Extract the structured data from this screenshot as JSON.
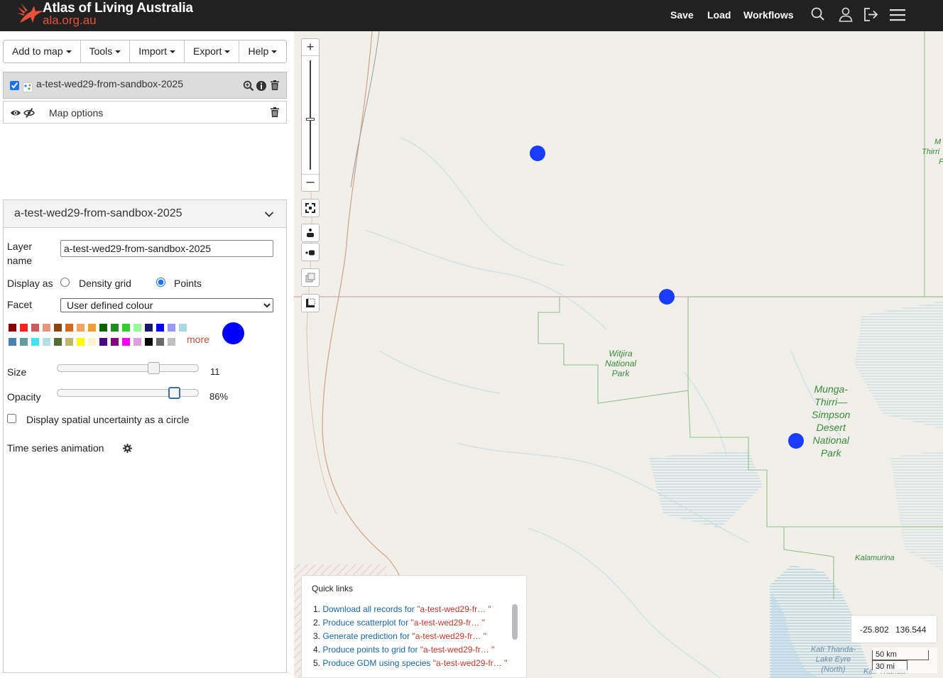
{
  "header": {
    "title": "Atlas of Living Australia",
    "subtitle": "ala.org.au",
    "nav": [
      "Save",
      "Load",
      "Workflows"
    ],
    "icons": [
      "search-icon",
      "user-icon",
      "logout-icon",
      "hamburger-menu-icon"
    ]
  },
  "menubar": {
    "items": [
      "Add to map",
      "Tools",
      "Import",
      "Export",
      "Help"
    ]
  },
  "layers": {
    "layer_name": "a-test-wed29-from-sandbox-2025",
    "layer_checked": true,
    "map_options_label": "Map options"
  },
  "style_panel": {
    "title": "a-test-wed29-from-sandbox-2025",
    "layer_name_label_1": "Layer",
    "layer_name_label_2": "name",
    "layer_name_value": "a-test-wed29-from-sandbox-2025",
    "display_as_label": "Display as",
    "display_options": [
      "Density grid",
      "Points"
    ],
    "display_selected": "Points",
    "facet_label": "Facet",
    "facet_value": "User defined colour",
    "palette": [
      "#8b0000",
      "#ff2020",
      "#cd5c5c",
      "#e9967a",
      "#8b4513",
      "#d2691e",
      "#f4a460",
      "#f0a030",
      "#006400",
      "#228b22",
      "#32cd32",
      "#98fb98",
      "#191970",
      "#0000ff",
      "#9999ff",
      "#add8e6",
      "#4682b4",
      "#5f9ea0",
      "#40e0ff",
      "#b0e0e6",
      "#556b2f",
      "#bdb76b",
      "#ffff00",
      "#fff5cc",
      "#4b0082",
      "#800080",
      "#ff00ff",
      "#dda0dd",
      "#000000",
      "#696969",
      "#c0c0c0"
    ],
    "more_label": "more",
    "selected_color": "#0000ff",
    "size_label": "Size",
    "size_value": "11",
    "size_fraction": 0.7,
    "opacity_label": "Opacity",
    "opacity_value": "86%",
    "opacity_fraction": 0.86,
    "uncertainty_label": "Display spatial uncertainty as a circle",
    "time_series_label": "Time series animation"
  },
  "map": {
    "labels": {
      "witjira": [
        "Witjira",
        "National",
        "Park"
      ],
      "munga": [
        "Munga-",
        "Thirri—",
        "Simpson",
        "Desert",
        "National",
        "Park"
      ],
      "kalamurina": "Kalamurina",
      "kati_thanda": [
        "Kati Thanda-",
        "Lake Eyre",
        "(North)"
      ],
      "kati_thanda_2": "Kati Thanda-",
      "edge_1": "M",
      "edge_2": "Thirri",
      "edge_3": "P"
    },
    "point_color": "#1a3cff"
  },
  "quick_links": {
    "title": "Quick links",
    "items": [
      {
        "num": "1.",
        "text": "Download all records for",
        "species": "\"a-test-wed29-fr… \""
      },
      {
        "num": "2.",
        "text": "Produce scatterplot for",
        "species": "\"a-test-wed29-fr… \""
      },
      {
        "num": "3.",
        "text": "Generate prediction for",
        "species": "\"a-test-wed29-fr… \""
      },
      {
        "num": "4.",
        "text": "Produce points to grid for",
        "species": "\"a-test-wed29-fr… \""
      },
      {
        "num": "5.",
        "text": "Produce GDM using species",
        "species": "\"a-test-wed29-fr… \""
      }
    ]
  },
  "coordinates": {
    "lat": "-25.802",
    "lon": "136.544"
  },
  "scale": {
    "km": "50 km",
    "mi": "30 mi"
  }
}
